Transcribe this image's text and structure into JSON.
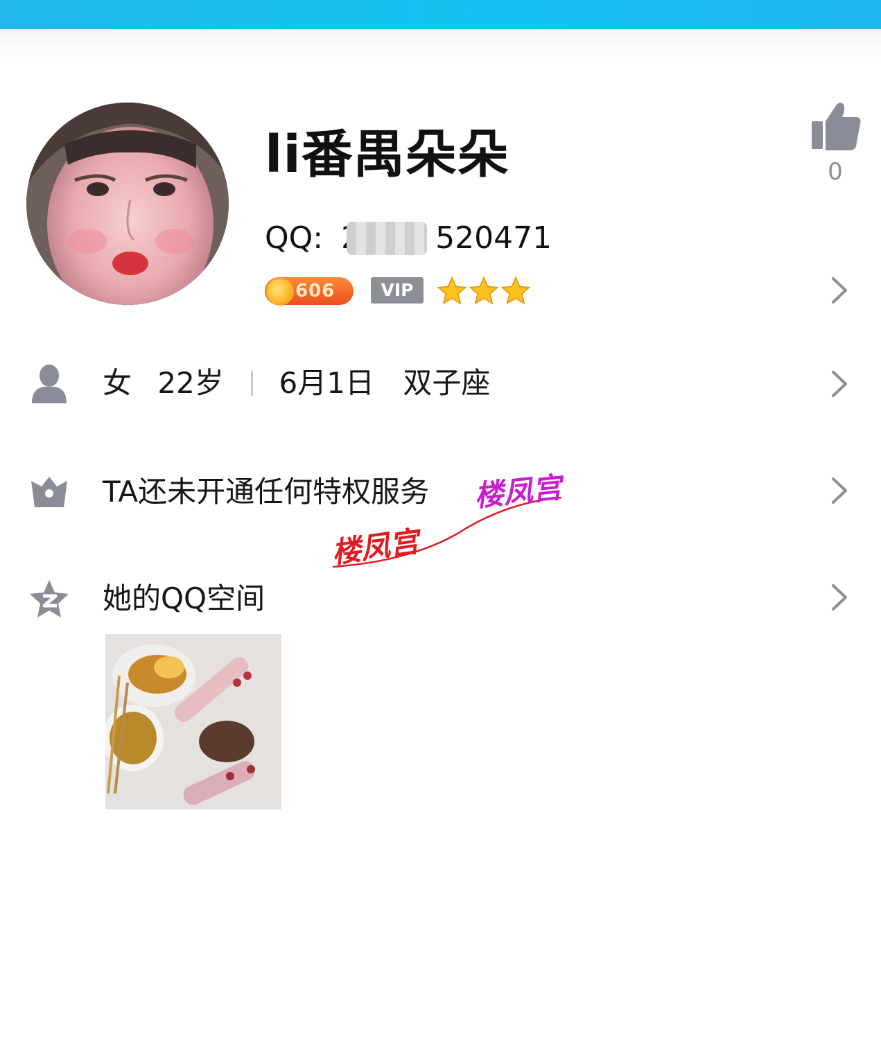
{
  "profile": {
    "name": "li番禺朵朵",
    "qq_label": "QQ:",
    "qq_prefix": "2",
    "qq_suffix": "520471",
    "level": "606",
    "vip": "VIP",
    "stars": 3,
    "likes": "0"
  },
  "info": {
    "gender": "女",
    "age": "22岁",
    "birthday": "6月1日",
    "zodiac": "双子座"
  },
  "privilege": {
    "text": "TA还未开通任何特权服务"
  },
  "qzone": {
    "title": "她的QQ空间"
  },
  "watermark": {
    "text_red": "楼凤宫",
    "text_purple": "楼凤宫"
  },
  "colors": {
    "top_bar": "#22b8ee",
    "icon_gray": "#8a8d97",
    "level_badge": "#e9501c",
    "vip_badge": "#8d8f96",
    "watermark_red": "#e01b22",
    "watermark_purple": "#c81ed0"
  }
}
